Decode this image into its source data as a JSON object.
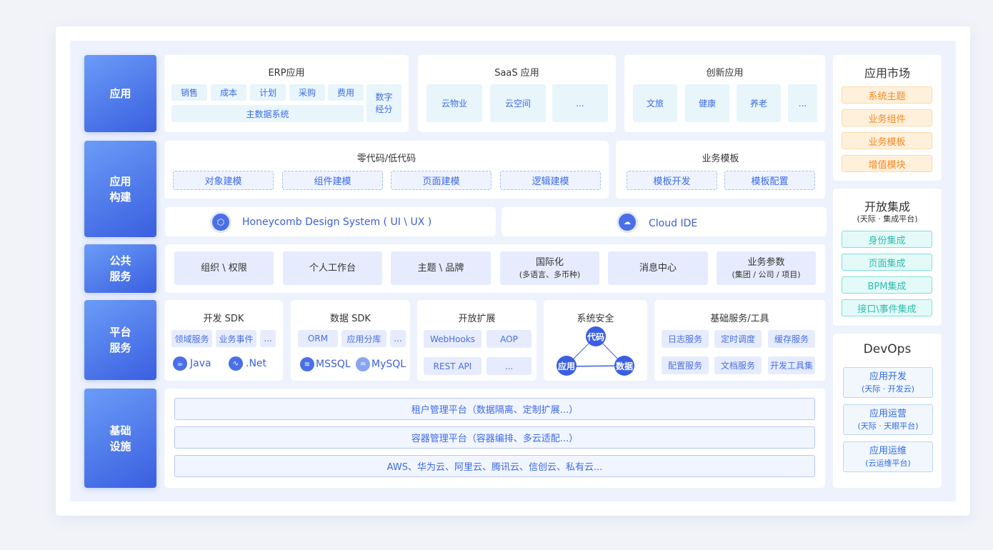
{
  "layers": [
    "应用",
    "应用\n构建",
    "公共\n服务",
    "平台\n服务",
    "基础\n设施"
  ],
  "apps": {
    "erp": {
      "title": "ERP应用",
      "items": [
        "销售",
        "成本",
        "计划",
        "采购",
        "费用"
      ],
      "master": "主数据系统",
      "analytics": "数字\n经分"
    },
    "saas": {
      "title": "SaaS 应用",
      "items": [
        "云物业",
        "云空间",
        "..."
      ]
    },
    "innov": {
      "title": "创新应用",
      "items": [
        "文旅",
        "健康",
        "养老",
        "..."
      ]
    }
  },
  "build": {
    "lowcode": {
      "title": "零代码/低代码",
      "items": [
        "对象建模",
        "组件建模",
        "页面建模",
        "逻辑建模"
      ]
    },
    "template": {
      "title": "业务模板",
      "items": [
        "模板开发",
        "模板配置"
      ]
    },
    "honeycomb": "Honeycomb Design System ( UI \\ UX )",
    "cloud_ide": "Cloud IDE"
  },
  "public": [
    {
      "t": "组织 \\ 权限"
    },
    {
      "t": "个人工作台"
    },
    {
      "t": "主题 \\ 品牌"
    },
    {
      "t": "国际化",
      "s": "(多语言、多币种)"
    },
    {
      "t": "消息中心"
    },
    {
      "t": "业务参数",
      "s": "(集团 / 公司 / 项目)"
    }
  ],
  "platform": {
    "devsdk": {
      "title": "开发 SDK",
      "items": [
        "领域服务",
        "业务事件",
        "..."
      ],
      "tech": [
        "Java",
        ".Net"
      ]
    },
    "datasdk": {
      "title": "数据 SDK",
      "items": [
        "ORM",
        "应用分库",
        "..."
      ],
      "tech": [
        "MSSQL",
        "MySQL"
      ]
    },
    "ext": {
      "title": "开放扩展",
      "items": [
        "WebHooks",
        "AOP",
        "REST API",
        "..."
      ]
    },
    "security": {
      "title": "系统安全",
      "nodes": [
        "代码",
        "应用",
        "数据"
      ]
    },
    "basic": {
      "title": "基础服务/工具",
      "items": [
        "日志服务",
        "定时调度",
        "缓存服务",
        "配置服务",
        "文档服务",
        "开发工具集"
      ]
    }
  },
  "infra": [
    "租户管理平台（数据隔离、定制扩展...）",
    "容器管理平台（容器编排、多云适配...）",
    "AWS、华为云、阿里云、腾讯云、信创云、私有云..."
  ],
  "market": {
    "title": "应用市场",
    "items": [
      "系统主题",
      "业务组件",
      "业务模板",
      "增值模块"
    ]
  },
  "integration": {
    "title": "开放集成",
    "subtitle": "(天际 · 集成平台)",
    "items": [
      "身份集成",
      "页面集成",
      "BPM集成",
      "接口\\事件集成"
    ]
  },
  "devops": {
    "title": "DevOps",
    "items": [
      {
        "t": "应用开发",
        "s": "(天际 · 开发云)"
      },
      {
        "t": "应用运营",
        "s": "(天际 · 天眼平台)"
      },
      {
        "t": "应用运维",
        "s": "(云运维平台)"
      }
    ]
  },
  "colors": {
    "primary": "#3d6ae8",
    "market": "#f7871f",
    "integration": "#2fbcb0"
  }
}
